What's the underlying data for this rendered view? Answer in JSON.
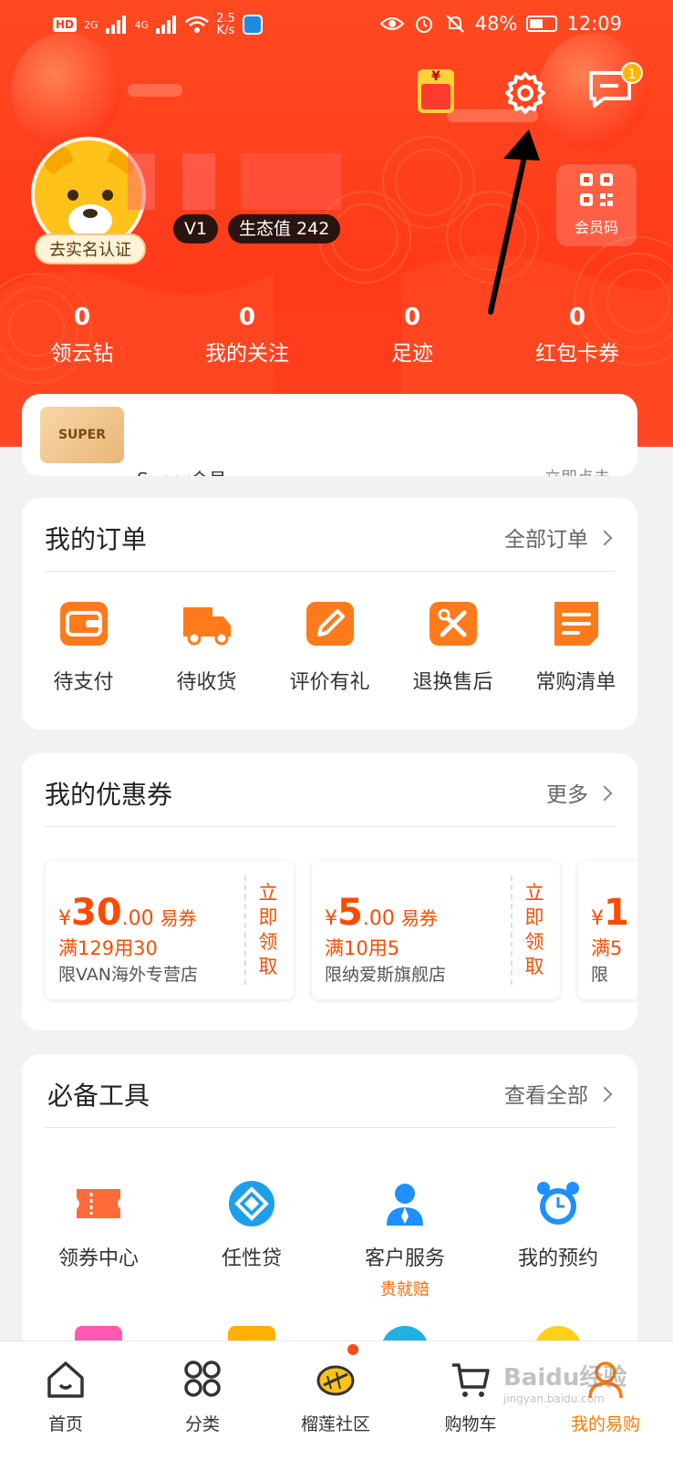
{
  "status_bar": {
    "hd": "HD",
    "net1": "2G",
    "net2": "4G",
    "speed_value": "2.5",
    "speed_unit": "K/s",
    "battery": "48%",
    "time": "12:09"
  },
  "header": {
    "message_badge": "1",
    "redpacket_symbol": "¥",
    "verify_label": "去实名认证",
    "level_tag": "V1",
    "eco_tag": "生态值 242",
    "member_code_label": "会员码",
    "stats": [
      {
        "value": "0",
        "label": "领云钻"
      },
      {
        "value": "0",
        "label": "我的关注"
      },
      {
        "value": "0",
        "label": "足迹"
      },
      {
        "value": "0",
        "label": "红包卡券"
      }
    ]
  },
  "super": {
    "logo": "SUPER",
    "title": "Super会员",
    "link": "立即点击"
  },
  "orders": {
    "title": "我的订单",
    "more": "全部订单",
    "items": [
      {
        "label": "待支付",
        "icon": "wallet-icon"
      },
      {
        "label": "待收货",
        "icon": "truck-icon"
      },
      {
        "label": "评价有礼",
        "icon": "edit-icon"
      },
      {
        "label": "退换售后",
        "icon": "tools-icon"
      },
      {
        "label": "常购清单",
        "icon": "list-icon"
      }
    ]
  },
  "coupons": {
    "title": "我的优惠券",
    "more": "更多",
    "items": [
      {
        "currency": "¥",
        "amount": "30",
        "decimals": ".00",
        "unit": "易券",
        "condition": "满129用30",
        "shop": "限VAN海外专营店",
        "action": "立即领取"
      },
      {
        "currency": "¥",
        "amount": "5",
        "decimals": ".00",
        "unit": "易券",
        "condition": "满10用5",
        "shop": "限纳爱斯旗舰店",
        "action": "立即领取"
      },
      {
        "currency": "¥",
        "amount": "1",
        "decimals": "",
        "unit": "",
        "condition": "满5",
        "shop": "限",
        "action": ""
      }
    ]
  },
  "tools": {
    "title": "必备工具",
    "more": "查看全部",
    "items": [
      {
        "label": "领券中心",
        "sub": "",
        "icon": "ticket-icon"
      },
      {
        "label": "任性贷",
        "sub": "",
        "icon": "loan-icon"
      },
      {
        "label": "客户服务",
        "sub": "贵就赔",
        "icon": "service-icon"
      },
      {
        "label": "我的预约",
        "sub": "",
        "icon": "alarm-icon"
      }
    ]
  },
  "tabbar": {
    "items": [
      {
        "label": "首页",
        "icon": "home-icon"
      },
      {
        "label": "分类",
        "icon": "category-icon"
      },
      {
        "label": "榴莲社区",
        "icon": "durian-icon"
      },
      {
        "label": "购物车",
        "icon": "cart-icon"
      },
      {
        "label": "我的易购",
        "icon": "profile-icon"
      }
    ]
  },
  "watermark": {
    "main": "Baidu经验",
    "sub": "jingyan.baidu.com"
  },
  "colors": {
    "brand_red": "#ff3b1c",
    "accent_orange": "#ff7a00",
    "coupon_orange": "#ff4a00"
  }
}
